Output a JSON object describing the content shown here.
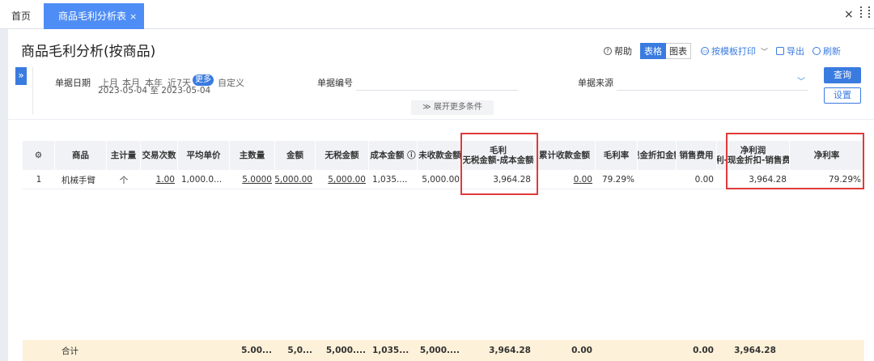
{
  "tabs": {
    "home": "首页",
    "active": "商品毛利分析表",
    "close": "×"
  },
  "window": {
    "close": "×"
  },
  "page": {
    "title": "商品毛利分析(按商品)"
  },
  "toolbar": {
    "help": "帮助",
    "view_table": "表格",
    "view_chart": "图表",
    "print": "按模板打印",
    "export": "导出",
    "refresh": "刷新"
  },
  "filters": {
    "date_label": "单据日期",
    "date_options": [
      "上月",
      "本月",
      "本年",
      "近7天"
    ],
    "more": "更多",
    "custom": "自定义",
    "date_range": "2023-05-04 至 2023-05-04",
    "doc_no_label": "单据编号",
    "doc_source_label": "单据来源",
    "query": "查询",
    "settings": "设置",
    "expand_more": "展开更多条件"
  },
  "table": {
    "headers": {
      "product": "商品",
      "unit": "主计量",
      "trade_count": "交易次数",
      "avg_price": "平均单价",
      "qty": "主数量",
      "amount": "金额",
      "net_amount": "无税金额",
      "cost": "成本金额 ⓘ",
      "unreceived": "未收款金额",
      "gross_profit_1": "毛利",
      "gross_profit_2": "无税金额-成本金额",
      "received": "累计收款金额",
      "gross_margin": "毛利率",
      "discount": "现金折扣金额",
      "sales_fee": "销售费用",
      "net_profit_1": "净利润",
      "net_profit_2": "毛利-现金折扣-销售费用",
      "net_margin": "净利率"
    },
    "row": {
      "no": "1",
      "product": "机械手臂",
      "unit": "个",
      "trade_count": "1.00",
      "avg_price": "1,000.0...",
      "qty": "5.0000",
      "amount": "5,000.00",
      "net_amount": "5,000.00",
      "cost": "1,035....",
      "unreceived": "5,000.00",
      "gross_profit": "3,964.28",
      "received": "0.00",
      "gross_margin": "79.29%",
      "discount": "",
      "sales_fee": "0.00",
      "net_profit": "3,964.28",
      "net_margin": "79.29%"
    },
    "footer": {
      "label": "合计",
      "qty": "5.00...",
      "amount": "5,0...",
      "net_amount": "5,000....",
      "cost": "1,035...",
      "unreceived": "5,000....",
      "gross_profit": "3,964.28",
      "received": "0.00",
      "sales_fee": "0.00",
      "net_profit": "3,964.28"
    }
  }
}
